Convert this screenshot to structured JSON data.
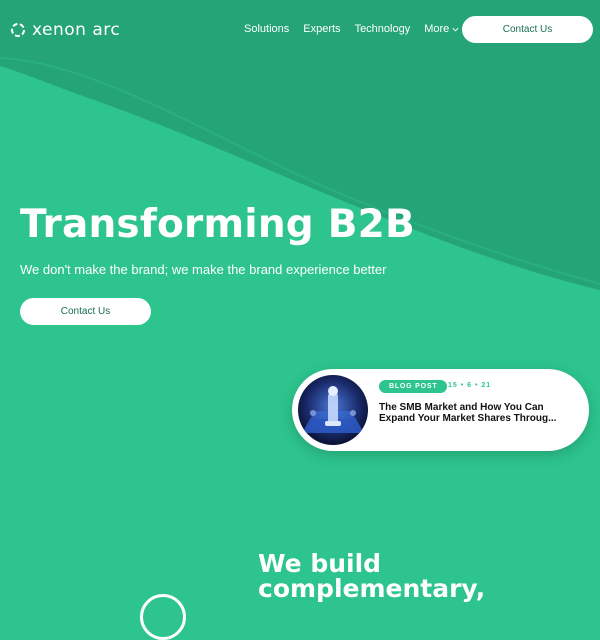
{
  "brand": {
    "name": "xenon arc"
  },
  "nav": {
    "links": [
      "Solutions",
      "Experts",
      "Technology"
    ],
    "more_label": "More",
    "contact_label": "Contact Us"
  },
  "hero": {
    "title": "Transforming B2B",
    "subtitle": "We don't make the brand; we make the brand experience better",
    "cta_label": "Contact Us"
  },
  "blog": {
    "badge": "BLOG POST",
    "date": "15 • 6 • 21",
    "title": "The SMB Market and How You Can Expand Your Market Shares Throug..."
  },
  "section": {
    "title": "We build complementary,"
  },
  "colors": {
    "background": "#2dc48d",
    "dark_band": "#25a577",
    "white": "#ffffff",
    "button_text": "#1b6e52"
  },
  "icons": {
    "logo": "hexagon-ring-icon",
    "more": "chevron-down-icon"
  }
}
